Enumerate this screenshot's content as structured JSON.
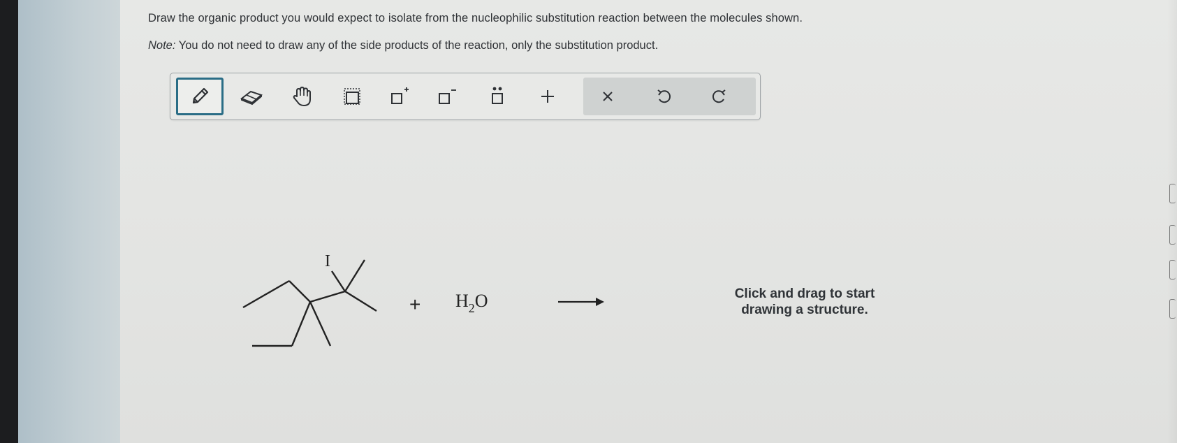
{
  "question": {
    "prompt": "Draw the organic product you would expect to isolate from the nucleophilic substitution reaction between the molecules shown.",
    "note_label": "Note:",
    "note_text": " You do not need to draw any of the side products of the reaction, only the substitution product."
  },
  "toolbar": {
    "tools": [
      {
        "name": "pencil-tool",
        "icon": "pencil-icon",
        "selected": true
      },
      {
        "name": "eraser-tool",
        "icon": "eraser-icon"
      },
      {
        "name": "hand-tool",
        "icon": "hand-icon"
      },
      {
        "name": "select-tool",
        "icon": "selection-box-icon"
      },
      {
        "name": "positive-charge-tool",
        "icon": "positive-charge-icon"
      },
      {
        "name": "negative-charge-tool",
        "icon": "negative-charge-icon"
      },
      {
        "name": "lone-pair-tool",
        "icon": "lone-pair-icon"
      },
      {
        "name": "zoom-in-tool",
        "icon": "plus-icon"
      },
      {
        "name": "clear-button",
        "icon": "close-icon"
      },
      {
        "name": "undo-button",
        "icon": "undo-icon"
      },
      {
        "name": "redo-button",
        "icon": "redo-icon"
      }
    ]
  },
  "reaction": {
    "reactant1_atom_label": "I",
    "plus": "+",
    "reactant2_main": "H",
    "reactant2_sub": "2",
    "reactant2_tail": "O"
  },
  "canvas": {
    "hint_line1": "Click and drag to start",
    "hint_line2": "drawing a structure."
  }
}
